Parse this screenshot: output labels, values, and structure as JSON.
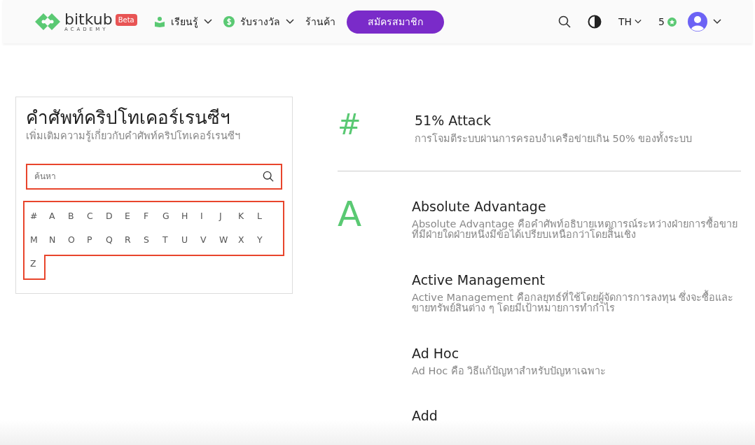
{
  "navbar": {
    "logo": {
      "name": "bitkub",
      "tagline": "ACADEMY",
      "badge": "Beta"
    },
    "menu": [
      {
        "label": "เรียนรู้",
        "kind": "dropdown"
      },
      {
        "label": "รับรางวัล",
        "kind": "dropdown"
      },
      {
        "label": "ร้านค้า",
        "kind": "link"
      }
    ],
    "signup_button": "สมัครสมาชิก",
    "language": "TH",
    "points": "5"
  },
  "sidebar": {
    "title": "คำศัพท์คริปโทเคอร์เรนซีฯ",
    "subtitle": "เพิ่มเติมความรู้เกี่ยวกับคำศัพท์คริปโทเคอร์เรนซีฯ",
    "search": {
      "placeholder": "ค้นหา"
    },
    "letters": [
      "#",
      "A",
      "B",
      "C",
      "D",
      "E",
      "F",
      "G",
      "H",
      "I",
      "J",
      "K",
      "L",
      "M",
      "N",
      "O",
      "P",
      "Q",
      "R",
      "S",
      "T",
      "U",
      "V",
      "W",
      "X",
      "Y",
      "Z"
    ]
  },
  "glossary": [
    {
      "letter": "#",
      "terms": [
        {
          "title": "51% Attack",
          "description": "การโจมตีระบบผ่านการครอบงำเครือข่ายเกิน 50% ของทั้งระบบ"
        }
      ]
    },
    {
      "letter": "A",
      "terms": [
        {
          "title": "Absolute Advantage",
          "description": "Absolute Advantage คือคำศัพท์อธิบายเหตุการณ์ระหว่างฝ่ายการซื้อขายที่มีฝ่ายใดฝ่ายหนึ่งมีข้อได้เปรียบเหนือกว่าโดยสิ้นเชิง"
        },
        {
          "title": "Active Management",
          "description": "Active Management คือกลยุทธ์ที่ใช้โดยผู้จัดการการลงทุน ซึ่งจะซื้อและขายทรัพย์สินต่าง ๆ โดยมีเป้าหมายการทำกำไร"
        },
        {
          "title": "Ad Hoc",
          "description": "Ad Hoc คือ วิธีแก้ปัญหาสำหรับปัญหาเฉพาะ"
        },
        {
          "title": "Add"
        }
      ]
    }
  ]
}
